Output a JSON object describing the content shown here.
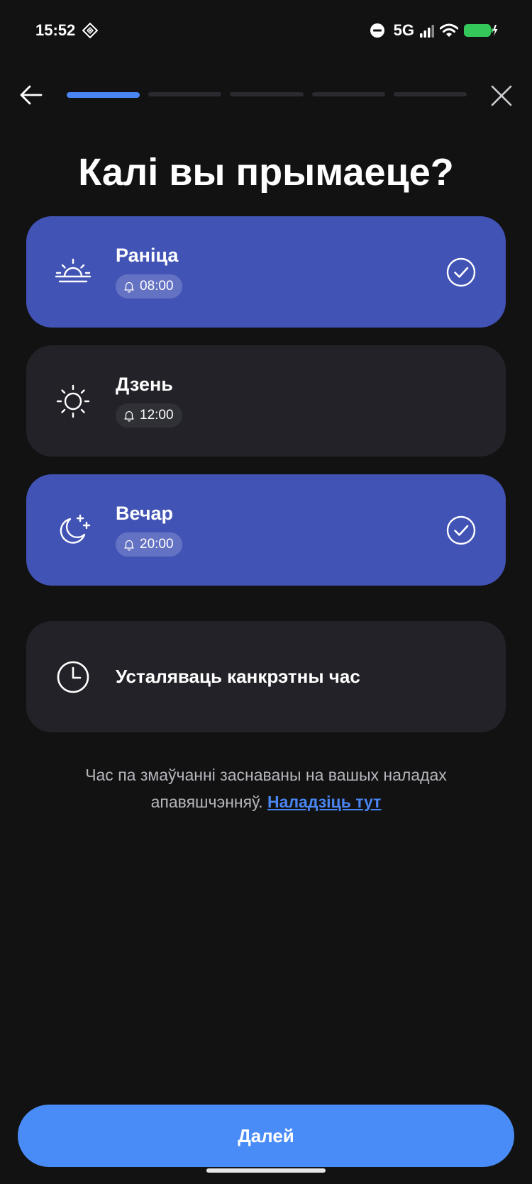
{
  "status_bar": {
    "time": "15:52",
    "network": "5G",
    "icons": [
      "app-notification-icon",
      "do-not-disturb-icon",
      "signal-icon",
      "wifi-icon",
      "battery-charging-icon"
    ]
  },
  "header": {
    "back_icon": "arrow-left-icon",
    "close_icon": "close-icon",
    "progress": {
      "total_steps": 5,
      "current_step": 1
    }
  },
  "title": "Калі вы прымаеце?",
  "options": [
    {
      "label": "Раніца",
      "time": "08:00",
      "selected": true,
      "icon": "sunrise-icon"
    },
    {
      "label": "Дзень",
      "time": "12:00",
      "selected": false,
      "icon": "sun-icon"
    },
    {
      "label": "Вечар",
      "time": "20:00",
      "selected": true,
      "icon": "moon-stars-icon"
    }
  ],
  "custom_option": {
    "label": "Усталяваць канкрэтны час",
    "icon": "clock-icon"
  },
  "note": {
    "text": "Час па змаўчанні заснаваны на вашых наладах апавяшчэнняў.",
    "link": "Наладзіць тут"
  },
  "primary_button": "Далей",
  "colors": {
    "background": "#121212",
    "card": "#222228",
    "card_selected": "#4253b6",
    "accent": "#4a86f3",
    "button": "#4a8cf7"
  }
}
